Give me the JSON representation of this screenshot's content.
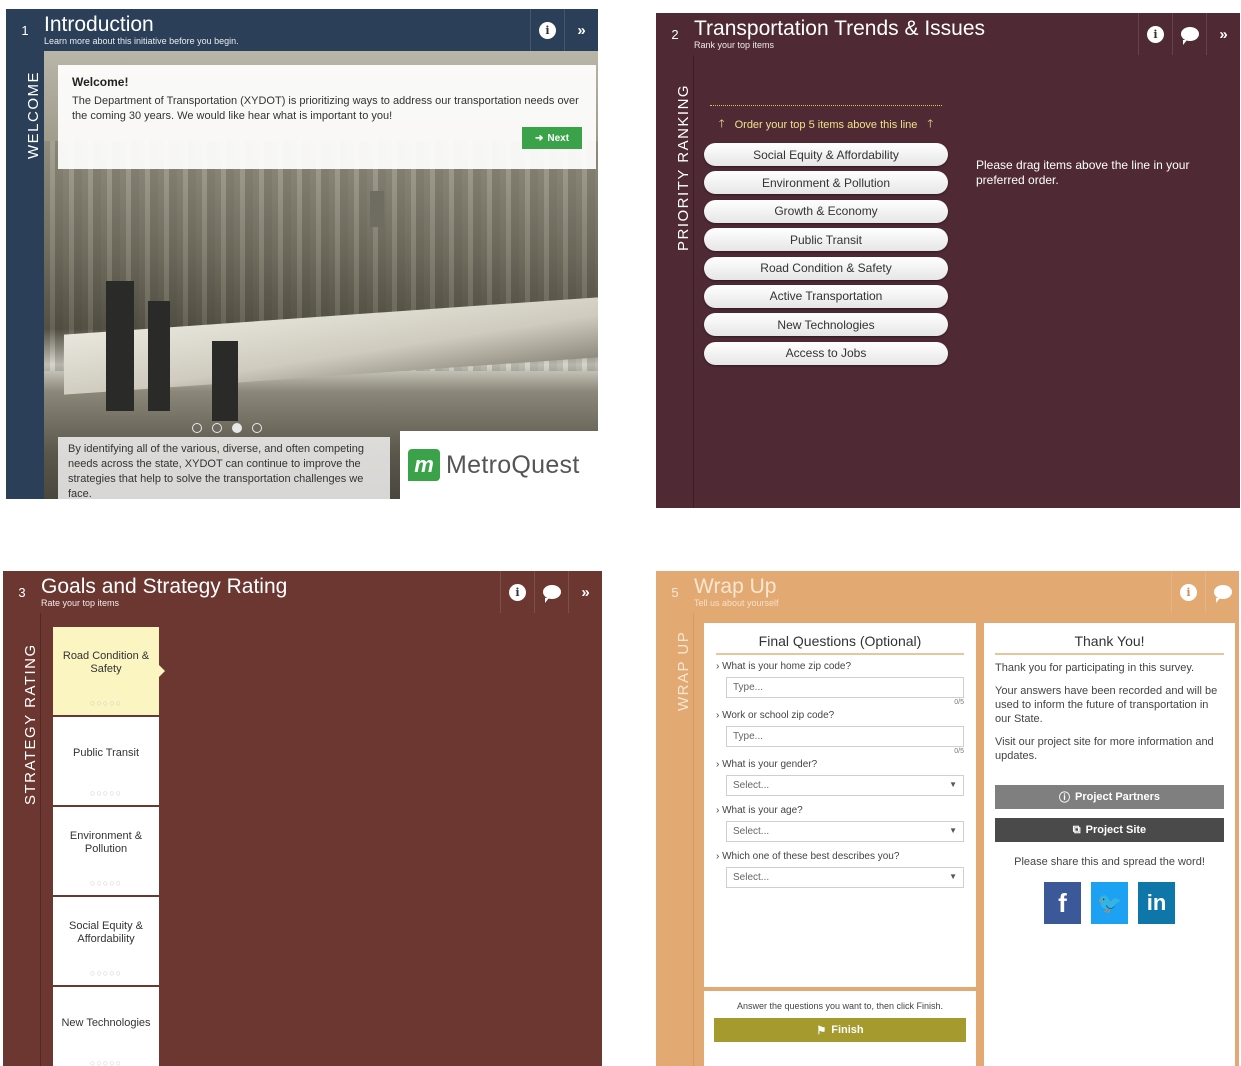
{
  "panel1": {
    "number": "1",
    "title": "Introduction",
    "subtitle": "Learn more about this initiative before you begin.",
    "rail_label": "WELCOME",
    "welcome_title": "Welcome!",
    "welcome_text": "The Department of Transportation (XYDOT) is prioritizing ways to address our transportation needs over the coming 30 years. We would like hear what is important to you!",
    "next_label": "Next",
    "caption": "By identifying all of the various, diverse, and often competing needs across the state, XYDOT can continue to improve the strategies that help to solve the transportation challenges we face.",
    "logo_text": "MetroQuest",
    "icons": [
      "info-icon",
      "expand-icon"
    ],
    "active_slide": 3,
    "slide_count": 4
  },
  "panel2": {
    "number": "2",
    "title": "Transportation Trends & Issues",
    "subtitle": "Rank your top items",
    "rail_label": "PRIORITY RANKING",
    "order_text": "Order your top 5 items above this line",
    "items": [
      "Social Equity & Affordability",
      "Environment & Pollution",
      "Growth & Economy",
      "Public Transit",
      "Road Condition & Safety",
      "Active Transportation",
      "New Technologies",
      "Access to Jobs"
    ],
    "drag_note": "Please drag items above the line in your preferred order.",
    "color": "#4f2a35"
  },
  "panel3": {
    "number": "3",
    "title": "Goals and Strategy Rating",
    "subtitle": "Rate your top items",
    "rail_label": "STRATEGY RATING",
    "items": [
      "Road Condition & Safety",
      "Public Transit",
      "Environment & Pollution",
      "Social Equity & Affordability",
      "New Technologies"
    ],
    "stars": "○○○○○",
    "color": "#6b3730"
  },
  "panel4": {
    "number": "5",
    "title": "Wrap Up",
    "subtitle": "Tell us about yourself",
    "rail_label": "WRAP UP",
    "final_title": "Final Questions (Optional)",
    "q1": "What is your home zip code?",
    "q1_placeholder": "Type...",
    "q1_counter": "0/5",
    "q2": "Work or school zip code?",
    "q2_placeholder": "Type...",
    "q2_counter": "0/5",
    "q3": "What is your gender?",
    "q3_value": "Select...",
    "q4": "What is your age?",
    "q4_value": "Select...",
    "q5": "Which one of these best describes you?",
    "q5_value": "Select...",
    "finish_note": "Answer the questions you want to, then click Finish.",
    "finish_label": "Finish",
    "thanks_title": "Thank You!",
    "thanks_1": "Thank you for participating in this survey.",
    "thanks_2": "Your answers have been recorded and will be used to inform the future of transportation in our State.",
    "thanks_3": "Visit our project site for more information and updates.",
    "partners_label": "Project Partners",
    "site_label": "Project Site",
    "share_text": "Please share this and spread the word!",
    "color": "#e2aa72"
  }
}
